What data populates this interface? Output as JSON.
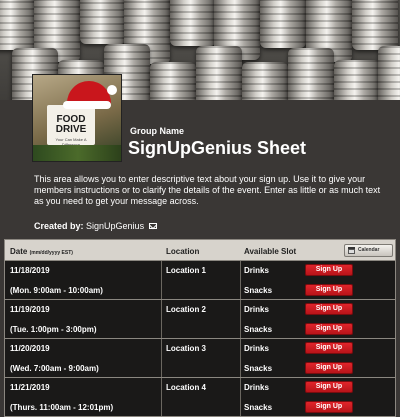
{
  "header": {
    "thumbnail_text": "FOOD DRIVE",
    "thumbnail_subtext": "Your Can Make A Difference",
    "group_label": "Group Name",
    "sheet_title": "SignUpGenius Sheet"
  },
  "description": "This area allows you to enter descriptive text about your sign up. Use it to give your members instructions or to clarify the details of the event. Enter as little or as much text as you need to get your message across.",
  "created_by": {
    "label": "Created by:",
    "name": "SignUpGenius",
    "icon": "mail-icon"
  },
  "table": {
    "columns": {
      "date": "Date",
      "date_format": "(mm/dd/yyyy EST)",
      "location": "Location",
      "slot": "Available Slot"
    },
    "calendar_button": "Calendar",
    "signup_label": "Sign Up",
    "rows": [
      {
        "date": "11/18/2019",
        "time": "(Mon. 9:00am - 10:00am)",
        "location": "Location 1",
        "slots": [
          "Drinks",
          "Snacks"
        ]
      },
      {
        "date": "11/19/2019",
        "time": "(Tue. 1:00pm - 3:00pm)",
        "location": "Location 2",
        "slots": [
          "Drinks",
          "Snacks"
        ]
      },
      {
        "date": "11/20/2019",
        "time": "(Wed. 7:00am - 9:00am)",
        "location": "Location 3",
        "slots": [
          "Drinks",
          "Snacks"
        ]
      },
      {
        "date": "11/21/2019",
        "time": "(Thurs. 11:00am - 12:01pm)",
        "location": "Location 4",
        "slots": [
          "Drinks",
          "Snacks"
        ]
      }
    ]
  },
  "colors": {
    "page_bg": "#3a3735",
    "header_bar": "#d7d3cc",
    "signup_red": "#d61e24"
  }
}
